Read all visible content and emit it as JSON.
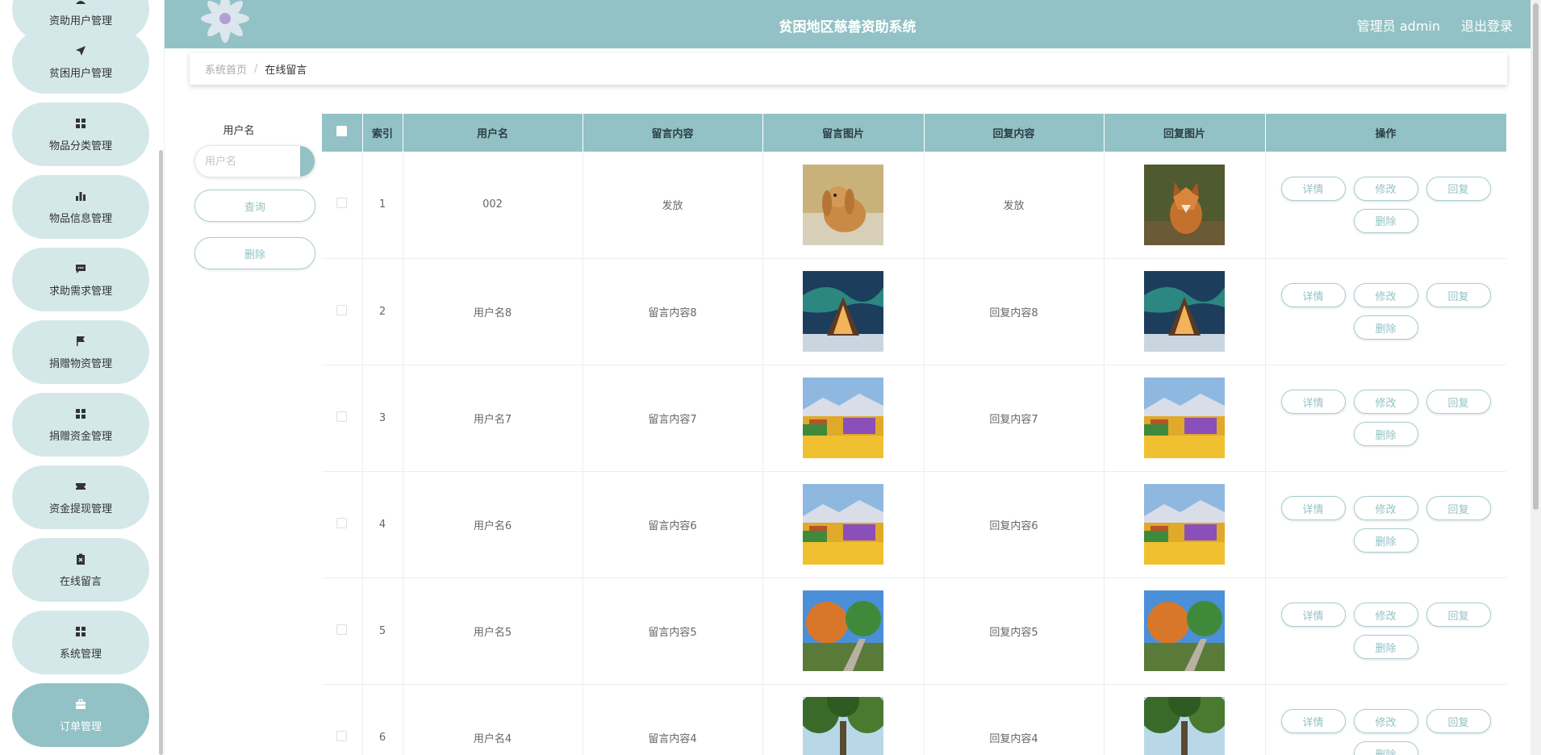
{
  "header": {
    "title": "贫困地区慈善资助系统",
    "user": "管理员 admin",
    "logout": "退出登录"
  },
  "sidebar": {
    "items": [
      {
        "label": "资助用户管理",
        "icon": "user-icon"
      },
      {
        "label": "贫困用户管理",
        "icon": "send-icon"
      },
      {
        "label": "物品分类管理",
        "icon": "grid-icon"
      },
      {
        "label": "物品信息管理",
        "icon": "bar-chart-icon"
      },
      {
        "label": "求助需求管理",
        "icon": "chat-icon"
      },
      {
        "label": "捐赠物资管理",
        "icon": "flag-icon"
      },
      {
        "label": "捐赠资金管理",
        "icon": "grid-icon"
      },
      {
        "label": "资金提现管理",
        "icon": "ticket-icon"
      },
      {
        "label": "在线留言",
        "icon": "clipboard-icon"
      },
      {
        "label": "系统管理",
        "icon": "grid-icon"
      },
      {
        "label": "订单管理",
        "icon": "briefcase-icon"
      }
    ],
    "active_index": 10
  },
  "breadcrumb": {
    "home": "系统首页",
    "separator": "/",
    "current": "在线留言"
  },
  "search": {
    "label": "用户名",
    "placeholder": "用户名",
    "value": "",
    "query_button": "查询",
    "delete_button": "删除"
  },
  "table": {
    "columns": [
      "索引",
      "用户名",
      "留言内容",
      "留言图片",
      "回复内容",
      "回复图片",
      "操作"
    ],
    "actions": {
      "detail": "详情",
      "edit": "修改",
      "reply": "回复",
      "delete": "删除"
    },
    "rows": [
      {
        "index": "1",
        "username": "002",
        "message": "发放",
        "message_image": "rabbit-photo",
        "reply": "发放",
        "reply_image": "fox-photo"
      },
      {
        "index": "2",
        "username": "用户名8",
        "message": "留言内容8",
        "message_image": "aurora-cabin-photo",
        "reply": "回复内容8",
        "reply_image": "aurora-cabin-photo"
      },
      {
        "index": "3",
        "username": "用户名7",
        "message": "留言内容7",
        "message_image": "flower-field-painting",
        "reply": "回复内容7",
        "reply_image": "flower-field-painting"
      },
      {
        "index": "4",
        "username": "用户名6",
        "message": "留言内容6",
        "message_image": "flower-field-painting",
        "reply": "回复内容6",
        "reply_image": "flower-field-painting"
      },
      {
        "index": "5",
        "username": "用户名5",
        "message": "留言内容5",
        "message_image": "autumn-stairs-photo",
        "reply": "回复内容5",
        "reply_image": "autumn-stairs-photo"
      },
      {
        "index": "6",
        "username": "用户名4",
        "message": "留言内容4",
        "message_image": "forest-canopy-photo",
        "reply": "回复内容4",
        "reply_image": "forest-canopy-photo"
      }
    ]
  },
  "colors": {
    "primary": "#92c2c5",
    "nav_bg": "#d4e8ea"
  }
}
